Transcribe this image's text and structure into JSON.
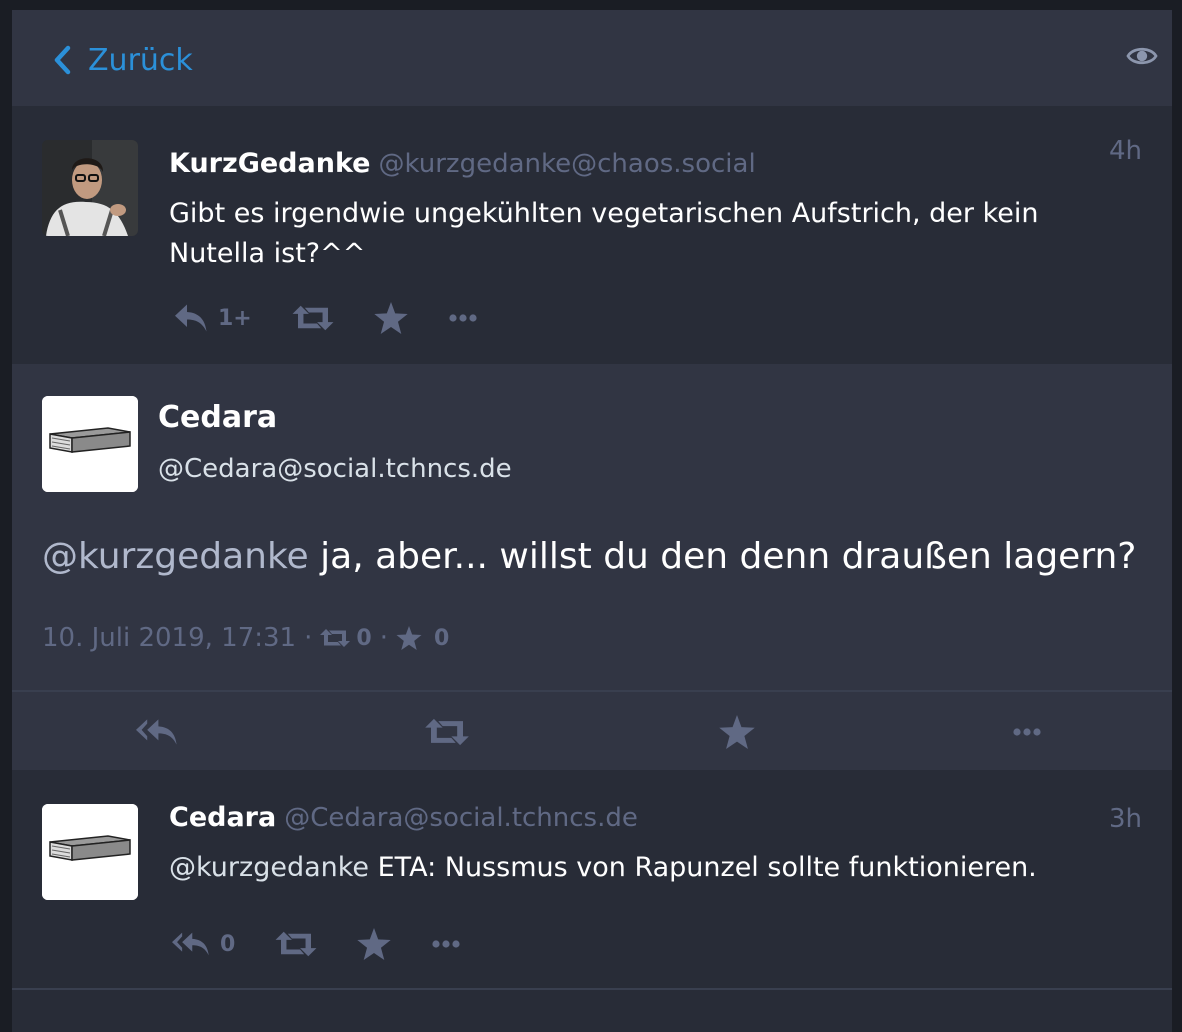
{
  "header": {
    "back_label": "Zurück",
    "back_icon": "chevron-left-icon",
    "visibility_icon": "eye-icon"
  },
  "status1": {
    "display_name": "KurzGedanke",
    "acct": "@kurzgedanke@chaos.social",
    "time": "4h",
    "content": "Gibt es irgendwie ungekühlten vegetarischen Aufstrich, der kein Nutella ist?^^",
    "reply_count": "1+"
  },
  "detailed": {
    "display_name": "Cedara",
    "acct": "@Cedara@social.tchncs.de",
    "mention": "@kurzgedanke",
    "text": " ja, aber... willst du den denn draußen lagern?",
    "date": "10. Juli 2019, 17:31",
    "sep": "·",
    "boosts": "0",
    "favourites": "0"
  },
  "status3": {
    "display_name": "Cedara",
    "acct": "@Cedara@social.tchncs.de",
    "time": "3h",
    "mention": "@kurzgedanke",
    "text": " ETA: Nussmus von Rapunzel sollte funktionieren.",
    "reply_count": "0"
  },
  "colors": {
    "accent": "#2b90d9",
    "muted": "#606984",
    "background": "#282c37",
    "header": "#313543"
  }
}
